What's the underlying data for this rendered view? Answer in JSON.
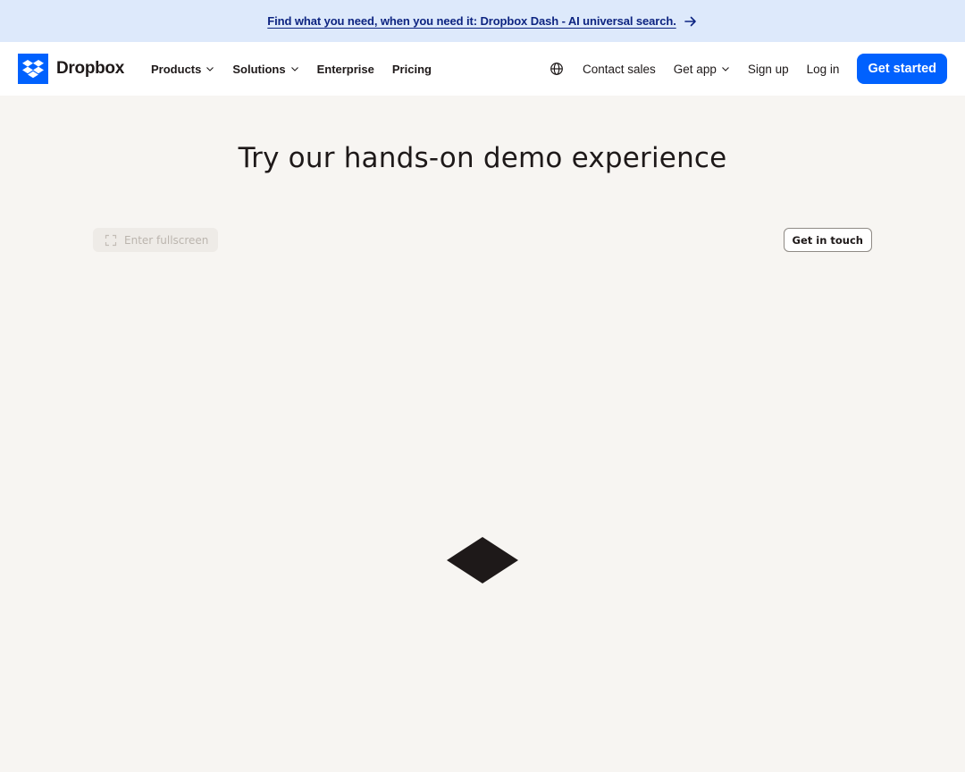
{
  "banner": {
    "text": "Find what you need, when you need it: Dropbox Dash - AI universal search.",
    "icon": "arrow-right-icon"
  },
  "nav": {
    "logo_text": "Dropbox",
    "left_items": [
      {
        "label": "Products",
        "has_dropdown": true
      },
      {
        "label": "Solutions",
        "has_dropdown": true
      },
      {
        "label": "Enterprise",
        "has_dropdown": false
      },
      {
        "label": "Pricing",
        "has_dropdown": false
      }
    ],
    "globe_icon": "globe-icon",
    "contact_sales": "Contact sales",
    "get_app": "Get app",
    "sign_up": "Sign up",
    "log_in": "Log in",
    "get_started": "Get started"
  },
  "hero": {
    "title": "Try our hands-on demo experience"
  },
  "demo": {
    "fullscreen_label": "Enter fullscreen",
    "get_in_touch": "Get in touch",
    "loader_icon": "dropbox-diamond-loader-icon"
  },
  "colors": {
    "brand_blue": "#0061fe",
    "banner_bg": "#dde9fb",
    "banner_text": "#0d2481",
    "page_bg": "#f7f5f2",
    "text_dark": "#1e1919"
  }
}
